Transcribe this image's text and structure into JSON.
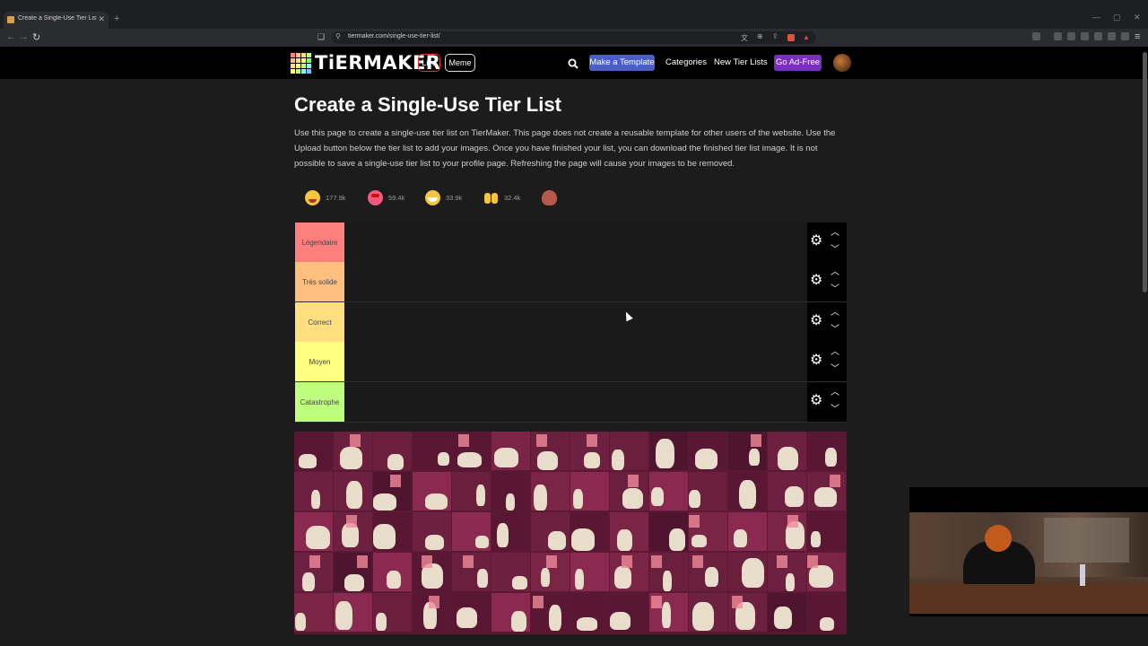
{
  "browser": {
    "tab_title": "Create a Single-Use Tier List (Fo...",
    "new_tab": "+",
    "url": "tiermaker.com/single-use-tier-list/"
  },
  "header": {
    "logo_text": "TiERMAKER",
    "live_label": "Live",
    "meme_label": "Meme",
    "make_template_label": "Make a Template",
    "categories_label": "Categories",
    "new_tier_lists_label": "New Tier Lists",
    "ad_free_label": "Go Ad-Free"
  },
  "page": {
    "title": "Create a Single-Use Tier List",
    "description": "Use this page to create a single-use tier list on TierMaker. This page does not create a reusable template for other users of the website. Use the Upload button below the tier list to add your images. Once you have finished your list, you can download the finished tier list image. It is not possible to save a single-use tier list to your profile page. Refreshing the page will cause your images to be removed."
  },
  "reactions": [
    {
      "icon": "grinning-face-icon",
      "count": "177.9k",
      "color": "#f5c542"
    },
    {
      "icon": "heart-eyes-icon",
      "count": "59.4k",
      "color": "#f05a7e"
    },
    {
      "icon": "laughing-face-icon",
      "count": "33.9k",
      "color": "#f5c542"
    },
    {
      "icon": "raised-hands-icon",
      "count": "32.4k",
      "color": "#f5c542"
    },
    {
      "icon": "poop-icon",
      "count": "",
      "color": "#b5594a"
    }
  ],
  "tiers": [
    {
      "label": "Légendaire",
      "color": "#ff7f7f"
    },
    {
      "label": "Très solide",
      "color": "#ffbf7f"
    },
    {
      "label": "Correct",
      "color": "#ffdf7f"
    },
    {
      "label": "Moyen",
      "color": "#ffff7f"
    },
    {
      "label": "Catastrophe",
      "color": "#bfff7f"
    }
  ],
  "colors": {
    "page_bg": "#1c1c1c",
    "make_template": "#4a5fc1",
    "ad_free": "#7a2fbf"
  }
}
